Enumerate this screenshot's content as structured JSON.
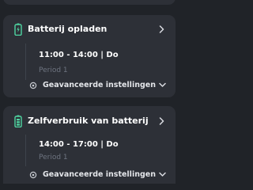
{
  "colors": {
    "background": "#202328",
    "card": "#2d3037",
    "accent_green": "#4fd6a2",
    "text_primary": "#ffffff",
    "text_muted": "#6e7480"
  },
  "cards": [
    {
      "title": "Batterij opladen",
      "icon": "battery-charge-icon",
      "time": "11:00 - 14:00 | Do",
      "period": "Period 1",
      "advanced_label": "Geavanceerde instellingen"
    },
    {
      "title": "Zelfverbruik van batterij",
      "icon": "battery-self-consumption-icon",
      "time": "14:00 - 17:00 | Do",
      "period": "Period 1",
      "advanced_label": "Geavanceerde instellingen"
    }
  ]
}
